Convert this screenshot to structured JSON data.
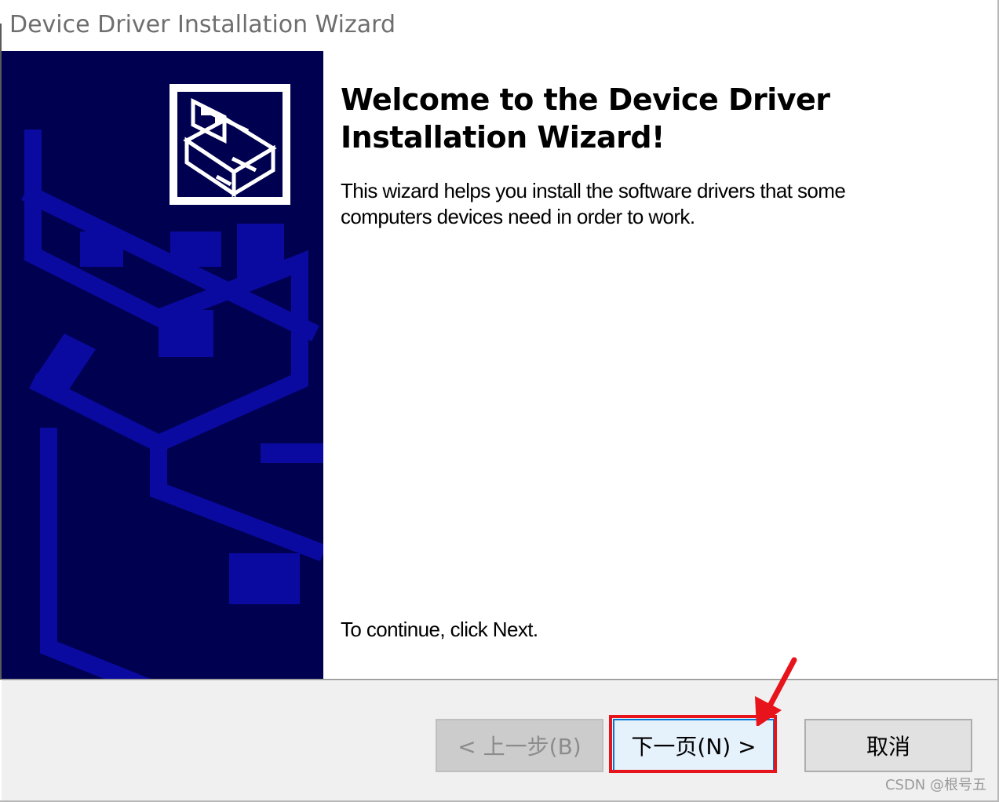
{
  "window": {
    "title": "Device Driver Installation Wizard"
  },
  "side_panel": {
    "background_color": "#000050",
    "icon": "hardware-device-icon"
  },
  "content": {
    "heading": "Welcome to the Device Driver Installation Wizard!",
    "description": "This wizard helps you install the software drivers that some computers devices need in order to work.",
    "continue_text": "To continue, click Next."
  },
  "buttons": {
    "back_label": "< 上一步(B)",
    "next_label": "下一页(N) >",
    "cancel_label": "取消"
  },
  "annotation": {
    "color": "#e8141b"
  },
  "watermark": "CSDN @根号五"
}
